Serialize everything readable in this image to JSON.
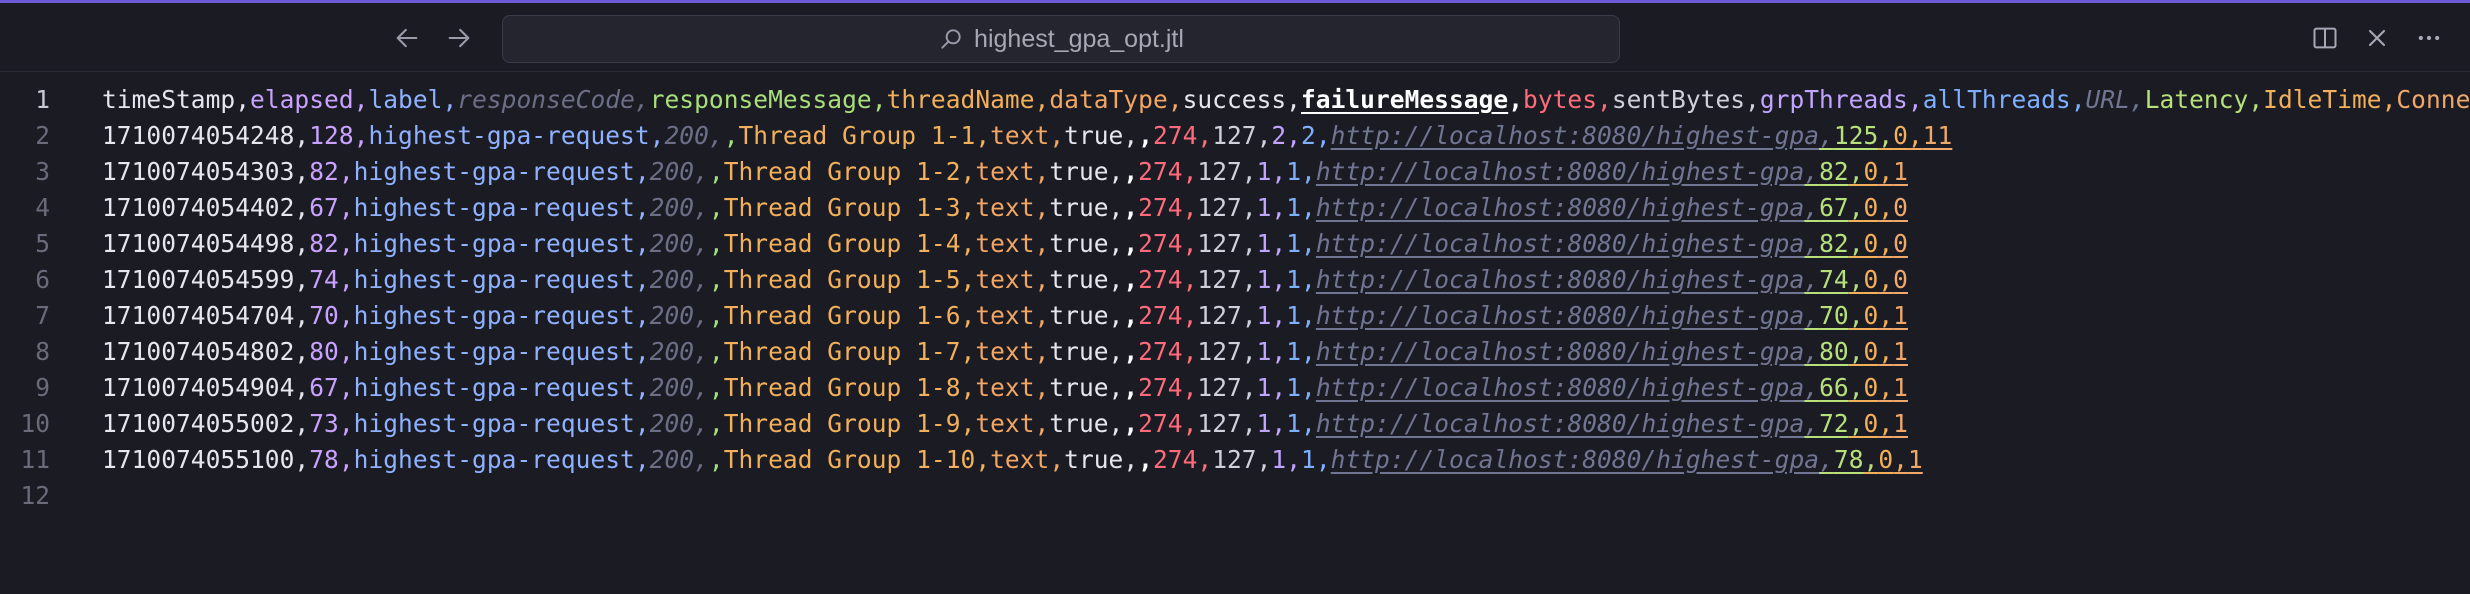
{
  "window": {
    "filename": "highest_gpa_opt.jtl",
    "accent_color": "#6b5bd6"
  },
  "icons": {
    "back": "arrow-left-icon",
    "forward": "arrow-right-icon",
    "search": "search-icon",
    "split": "split-editor-icon",
    "close": "close-icon",
    "more": "more-icon"
  },
  "editor": {
    "line_numbers": [
      "1",
      "2",
      "3",
      "4",
      "5",
      "6",
      "7",
      "8",
      "9",
      "10",
      "11",
      "12"
    ],
    "header": [
      "timeStamp",
      "elapsed",
      "label",
      "responseCode",
      "responseMessage",
      "threadName",
      "dataType",
      "success",
      "failureMessage",
      "bytes",
      "sentBytes",
      "grpThreads",
      "allThreads",
      "URL",
      "Latency",
      "IdleTime",
      "Connect"
    ],
    "rows": [
      [
        "1710074054248",
        "128",
        "highest-gpa-request",
        "200",
        "",
        "Thread Group 1-1",
        "text",
        "true",
        "",
        "274",
        "127",
        "2",
        "2",
        "http://localhost:8080/highest-gpa",
        "125",
        "0",
        "11"
      ],
      [
        "1710074054303",
        "82",
        "highest-gpa-request",
        "200",
        "",
        "Thread Group 1-2",
        "text",
        "true",
        "",
        "274",
        "127",
        "1",
        "1",
        "http://localhost:8080/highest-gpa",
        "82",
        "0",
        "1"
      ],
      [
        "1710074054402",
        "67",
        "highest-gpa-request",
        "200",
        "",
        "Thread Group 1-3",
        "text",
        "true",
        "",
        "274",
        "127",
        "1",
        "1",
        "http://localhost:8080/highest-gpa",
        "67",
        "0",
        "0"
      ],
      [
        "1710074054498",
        "82",
        "highest-gpa-request",
        "200",
        "",
        "Thread Group 1-4",
        "text",
        "true",
        "",
        "274",
        "127",
        "1",
        "1",
        "http://localhost:8080/highest-gpa",
        "82",
        "0",
        "0"
      ],
      [
        "1710074054599",
        "74",
        "highest-gpa-request",
        "200",
        "",
        "Thread Group 1-5",
        "text",
        "true",
        "",
        "274",
        "127",
        "1",
        "1",
        "http://localhost:8080/highest-gpa",
        "74",
        "0",
        "0"
      ],
      [
        "1710074054704",
        "70",
        "highest-gpa-request",
        "200",
        "",
        "Thread Group 1-6",
        "text",
        "true",
        "",
        "274",
        "127",
        "1",
        "1",
        "http://localhost:8080/highest-gpa",
        "70",
        "0",
        "1"
      ],
      [
        "1710074054802",
        "80",
        "highest-gpa-request",
        "200",
        "",
        "Thread Group 1-7",
        "text",
        "true",
        "",
        "274",
        "127",
        "1",
        "1",
        "http://localhost:8080/highest-gpa",
        "80",
        "0",
        "1"
      ],
      [
        "1710074054904",
        "67",
        "highest-gpa-request",
        "200",
        "",
        "Thread Group 1-8",
        "text",
        "true",
        "",
        "274",
        "127",
        "1",
        "1",
        "http://localhost:8080/highest-gpa",
        "66",
        "0",
        "1"
      ],
      [
        "1710074055002",
        "73",
        "highest-gpa-request",
        "200",
        "",
        "Thread Group 1-9",
        "text",
        "true",
        "",
        "274",
        "127",
        "1",
        "1",
        "http://localhost:8080/highest-gpa",
        "72",
        "0",
        "1"
      ],
      [
        "1710074055100",
        "78",
        "highest-gpa-request",
        "200",
        "",
        "Thread Group 1-10",
        "text",
        "true",
        "",
        "274",
        "127",
        "1",
        "1",
        "http://localhost:8080/highest-gpa",
        "78",
        "0",
        "1"
      ]
    ]
  }
}
